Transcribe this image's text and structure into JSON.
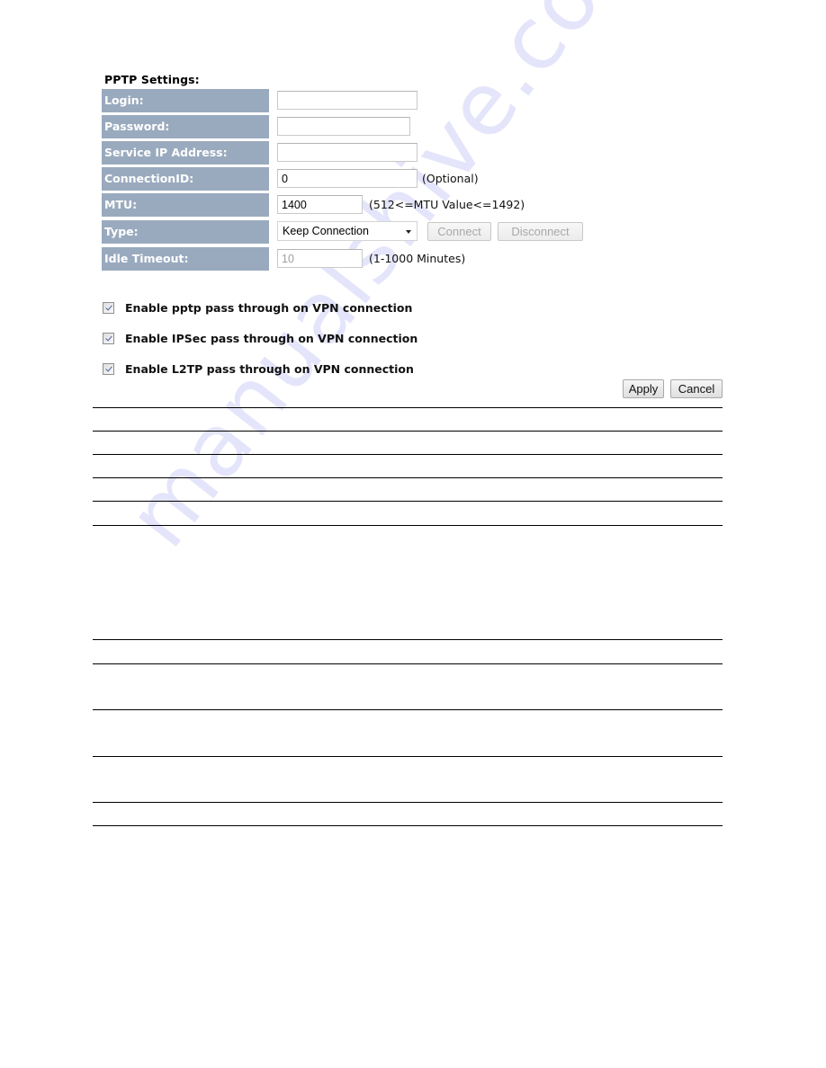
{
  "section": {
    "title": "PPTP Settings:"
  },
  "fields": {
    "login": {
      "label": "Login:",
      "value": ""
    },
    "password": {
      "label": "Password:",
      "value": ""
    },
    "service_ip": {
      "label": "Service IP Address:",
      "value": ""
    },
    "connection_id": {
      "label": "ConnectionID:",
      "value": "0",
      "hint": "(Optional)"
    },
    "mtu": {
      "label": "MTU:",
      "value": "1400",
      "hint": "(512<=MTU Value<=1492)"
    },
    "type": {
      "label": "Type:",
      "selected": "Keep Connection",
      "connect_label": "Connect",
      "disconnect_label": "Disconnect"
    },
    "idle_timeout": {
      "label": "Idle Timeout:",
      "value": "10",
      "hint": "(1-1000 Minutes)"
    }
  },
  "passthrough": [
    {
      "label": "Enable pptp pass through on VPN connection",
      "checked": true
    },
    {
      "label": "Enable IPSec pass through on VPN connection",
      "checked": true
    },
    {
      "label": "Enable L2TP pass through on VPN connection",
      "checked": true
    }
  ],
  "actions": {
    "apply_label": "Apply",
    "cancel_label": "Cancel"
  },
  "watermark": "manualshive.com",
  "colors": {
    "label_bg": "#9aaabe",
    "label_text": "#ffffff"
  }
}
